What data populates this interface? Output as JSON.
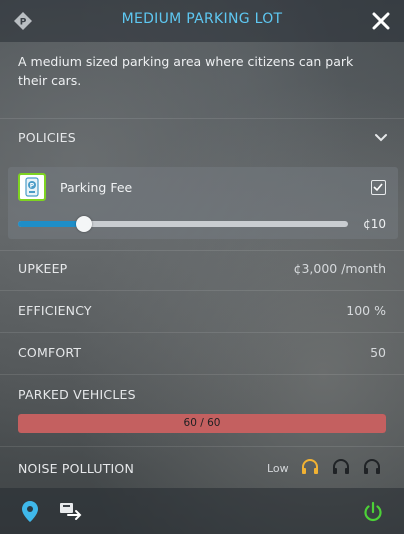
{
  "header": {
    "title": "MEDIUM PARKING LOT",
    "icon": "building-info-icon",
    "close_icon": "close-icon"
  },
  "description": "A medium sized parking area where citizens can park their cars.",
  "policies": {
    "label": "POLICIES",
    "expanded_icon": "chevron-down-icon",
    "items": [
      {
        "name": "Parking Fee",
        "icon": "parking-fee-icon",
        "enabled": true,
        "slider_fraction": 0.2,
        "value_text": "¢10"
      }
    ]
  },
  "stats": {
    "upkeep_label": "UPKEEP",
    "upkeep_value": "¢3,000 /month",
    "efficiency_label": "EFFICIENCY",
    "efficiency_value": "100 %",
    "comfort_label": "COMFORT",
    "comfort_value": "50"
  },
  "parked_vehicles": {
    "label": "PARKED VEHICLES",
    "text": "60 / 60",
    "fraction": 1.0
  },
  "noise_pollution": {
    "label": "NOISE POLLUTION",
    "level_text": "Low",
    "level": 1,
    "max_level": 3
  },
  "footer": {
    "locate_icon": "location-pin-icon",
    "route_icon": "route-icon",
    "power_icon": "power-icon"
  },
  "colors": {
    "title": "#5ec8f2",
    "slider_fill": "#1f8ec8",
    "bar_fill": "#c46060",
    "policy_icon_border": "#7ed321",
    "power": "#4cd137",
    "headphones_active": "#f2b233"
  }
}
